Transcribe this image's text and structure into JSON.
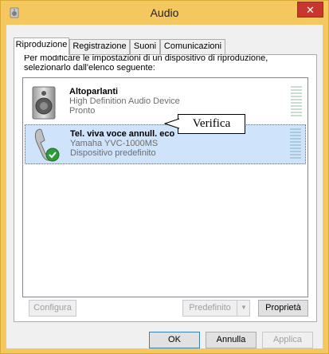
{
  "window": {
    "title": "Audio",
    "close_glyph": "✕"
  },
  "tabs": [
    {
      "label": "Riproduzione",
      "active": true
    },
    {
      "label": "Registrazione",
      "active": false
    },
    {
      "label": "Suoni",
      "active": false
    },
    {
      "label": "Comunicazioni",
      "active": false
    }
  ],
  "instruction": "Per modificare le impostazioni di un dispositivo di riproduzione, selezionarlo dall'elenco seguente:",
  "devices": [
    {
      "name": "Altoparlanti",
      "description": "High Definition Audio Device",
      "status": "Pronto",
      "icon": "speaker-icon",
      "selected": false
    },
    {
      "name": "Tel. viva voce annull. eco",
      "description": "Yamaha YVC-1000MS",
      "status": "Dispositivo predefinito",
      "icon": "speakerphone-icon",
      "selected": true,
      "badge": "default-check-icon"
    }
  ],
  "callout": {
    "text": "Verifica"
  },
  "buttons": {
    "configure": "Configura",
    "set_default": "Predefinito",
    "properties": "Proprietà",
    "ok": "OK",
    "cancel": "Annulla",
    "apply": "Applica"
  },
  "colors": {
    "titlebar": "#f4c75f",
    "close": "#c7372f",
    "selection": "#cfe4fb"
  }
}
